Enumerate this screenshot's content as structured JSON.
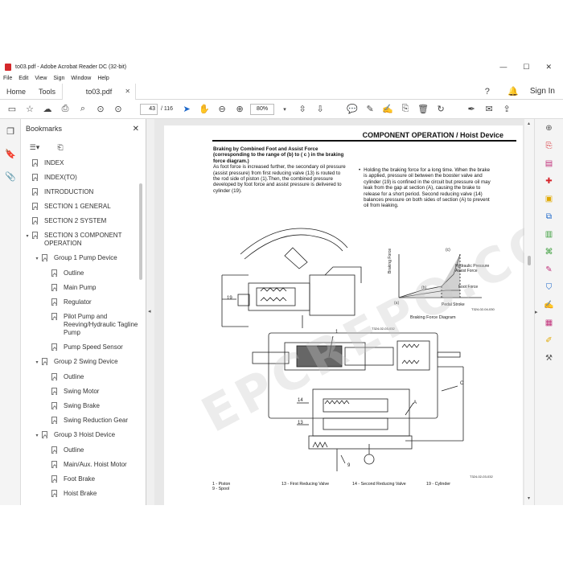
{
  "window": {
    "title": "to03.pdf - Adobe Acrobat Reader DC (32-bit)",
    "min": "—",
    "max": "☐",
    "close": "✕"
  },
  "menu": [
    "File",
    "Edit",
    "View",
    "Sign",
    "Window",
    "Help"
  ],
  "tabs": {
    "home": "Home",
    "tools": "Tools",
    "doc": "to03.pdf",
    "doc_close": "✕",
    "sign_in": "Sign In"
  },
  "toolbar": {
    "page_current": "43",
    "page_total": "/ 116",
    "zoom": "80%"
  },
  "bookmarks": {
    "title": "Bookmarks",
    "close": "✕",
    "items": [
      {
        "label": "INDEX",
        "level": 0,
        "toggle": ""
      },
      {
        "label": "INDEX(TO)",
        "level": 0,
        "toggle": ""
      },
      {
        "label": "INTRODUCTION",
        "level": 0,
        "toggle": ""
      },
      {
        "label": "SECTION 1 GENERAL",
        "level": 0,
        "toggle": ""
      },
      {
        "label": "SECTION 2 SYSTEM",
        "level": 0,
        "toggle": ""
      },
      {
        "label": "SECTION 3 COMPONENT OPERATION",
        "level": 0,
        "toggle": "▾"
      },
      {
        "label": "Group 1 Pump Device",
        "level": 1,
        "toggle": "▾"
      },
      {
        "label": "Outline",
        "level": 2,
        "toggle": ""
      },
      {
        "label": "Main Pump",
        "level": 2,
        "toggle": ""
      },
      {
        "label": "Regulator",
        "level": 2,
        "toggle": ""
      },
      {
        "label": "Pilot Pump and Reeving/Hydraulic Tagline Pump",
        "level": 2,
        "toggle": ""
      },
      {
        "label": "Pump Speed Sensor",
        "level": 2,
        "toggle": ""
      },
      {
        "label": "Group 2 Swing Device",
        "level": 1,
        "toggle": "▾"
      },
      {
        "label": "Outline",
        "level": 2,
        "toggle": ""
      },
      {
        "label": "Swing Motor",
        "level": 2,
        "toggle": ""
      },
      {
        "label": "Swing Brake",
        "level": 2,
        "toggle": ""
      },
      {
        "label": "Swing Reduction Gear",
        "level": 2,
        "toggle": ""
      },
      {
        "label": "Group 3 Hoist Device",
        "level": 1,
        "toggle": "▾"
      },
      {
        "label": "Outline",
        "level": 2,
        "toggle": ""
      },
      {
        "label": "Main/Aux. Hoist Motor",
        "level": 2,
        "toggle": ""
      },
      {
        "label": "Foot Brake",
        "level": 2,
        "toggle": ""
      },
      {
        "label": "Hoist Brake",
        "level": 2,
        "toggle": ""
      }
    ]
  },
  "doc": {
    "header": "COMPONENT OPERATION / Hoist Device",
    "left_heading": "Braking by Combined Foot and Assist Force (corresponding to the range of (b) to ( c ) in the braking force diagram.)",
    "left_body": "As foot force is increased further, the secondary oil pressure (assist pressure) from first reducing valve (13) is routed to the rod side of piston (1).Then, the combined pressure developed by foot force and assist pressure is delivered to cylinder (19).",
    "right_bullet": "•",
    "right_body": "Holding the braking force for a long time. When the brake is applied, pressure oil between the booster valve and cylinder (19) is confined in the circuit but pressure oil may leak from the gap at section (A), causing the brake to release for a short period. Second reducing valve (14) balances pressure on both sides of section (A) to prevent oil from leaking.",
    "graph": {
      "ylabel": "Braking Force",
      "xlabel": "Pedal Stroke",
      "labels": [
        "(c)",
        "(b)",
        "(a)"
      ],
      "legend_hyd": "Hydraulic Pressure Assist Force",
      "legend_foot": "Foot Force",
      "title": "Braking Force Diagram",
      "code": "T324-02-04-030"
    },
    "upper_code": "T324-02-03-032",
    "lower_code": "T324-02-03-032",
    "callouts": {
      "c1": "1",
      "c19": "19",
      "c14": "14",
      "c13": "13",
      "c9": "9",
      "cA": "A",
      "cC": "C"
    },
    "legend": {
      "l1": "1 -   Piston",
      "l9": "9 -   Spool",
      "l13": "13 -  First Reducing Valve",
      "l14": "14 -  Second Reducing Valve",
      "l19": "19 -  Cylinder"
    },
    "watermark": "EPCREPO.COM"
  }
}
